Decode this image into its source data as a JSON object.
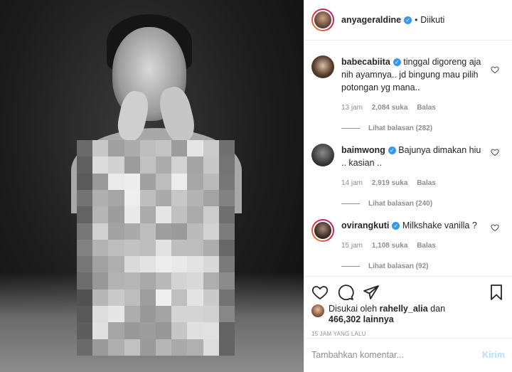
{
  "post": {
    "username": "anyageraldine",
    "follow_label": "Diikuti"
  },
  "comments": [
    {
      "username": "babecabiita",
      "text": "tinggal digoreng aja nih ayamnya.. jd bingung mau pilih potongan yg mana..",
      "time": "13 jam",
      "likes": "2,084 suka",
      "reply_label": "Balas",
      "view_replies": "Lihat balasan (282)"
    },
    {
      "username": "baimwong",
      "text": "Bajunya dimakan hiu .. kasian ..",
      "time": "14 jam",
      "likes": "2,919 suka",
      "reply_label": "Balas",
      "view_replies": "Lihat balasan (240)"
    },
    {
      "username": "ovirangkuti",
      "text": "Milkshake vanilla ?",
      "time": "15 jam",
      "likes": "1,108 suka",
      "reply_label": "Balas",
      "view_replies": "Lihat balasan (92)"
    }
  ],
  "liked": {
    "prefix": "Disukai oleh",
    "user": "rahelly_alia",
    "and": "dan",
    "count": "466,302",
    "suffix": "lainnya"
  },
  "timestamp": "15 JAM YANG LALU",
  "add_comment": {
    "placeholder": "Tambahkan komentar...",
    "send_label": "Kirim"
  },
  "icons": [
    "heart-icon",
    "comment-icon",
    "share-icon",
    "bookmark-icon"
  ],
  "colors": {
    "accent": "#3897f0",
    "send_disabled": "#b2dffc",
    "muted": "#8e8e8e"
  }
}
